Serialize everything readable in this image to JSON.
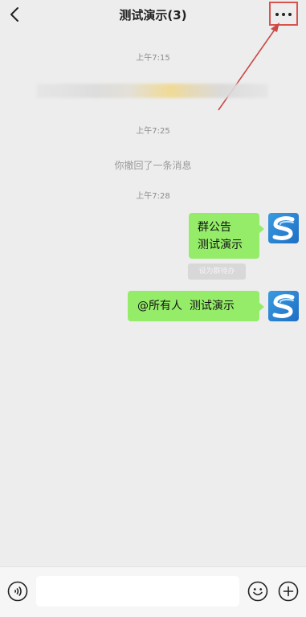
{
  "header": {
    "title": "测试演示(3)",
    "back_icon": "chevron-left-icon",
    "more_icon": "more-horizontal-icon"
  },
  "chat": {
    "timestamps": [
      "上午7:15",
      "上午7:25",
      "上午7:28"
    ],
    "recall_notice": "你撤回了一条消息",
    "messages": [
      {
        "lines": [
          "群公告",
          "测试演示"
        ],
        "action_label": "设为群待办"
      },
      {
        "lines": [
          "@所有人  测试演示"
        ]
      }
    ]
  },
  "composer": {
    "input_value": "",
    "voice_icon": "voice-icon",
    "emoji_icon": "emoji-icon",
    "plus_icon": "plus-circle-icon"
  },
  "colors": {
    "bubble": "#95ec69",
    "background": "#ededed",
    "highlight": "#d9534f"
  }
}
